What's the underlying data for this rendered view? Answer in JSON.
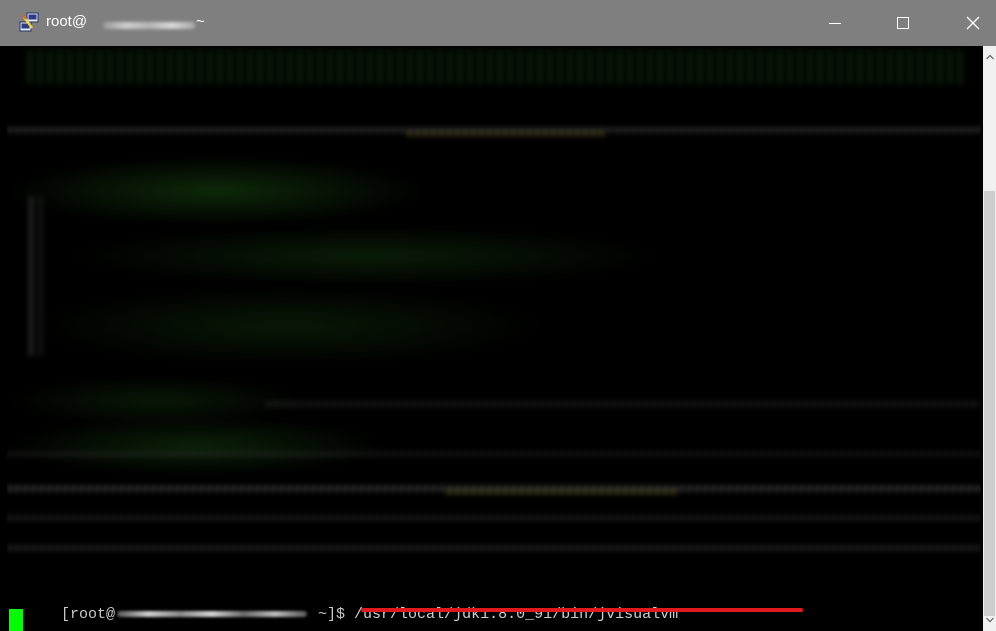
{
  "window": {
    "title_prefix": "root@",
    "title_suffix": "~"
  },
  "titlebar": {
    "minimize_glyph": "—",
    "maximize_glyph": "☐",
    "close_glyph": "✕"
  },
  "terminal": {
    "prompt_start": "[root@",
    "prompt_end": " ~]$ ",
    "command": "/usr/local/jdk1.8.0_91/bin/jvisualvm"
  },
  "colors": {
    "titlebar": "#7f7f7f",
    "terminal_bg": "#000000",
    "cursor": "#00ff00",
    "underline": "#e0181f"
  },
  "icons": [
    "putty-icon",
    "minimize-icon",
    "maximize-icon",
    "close-icon",
    "scroll-up-icon",
    "scroll-down-icon"
  ]
}
